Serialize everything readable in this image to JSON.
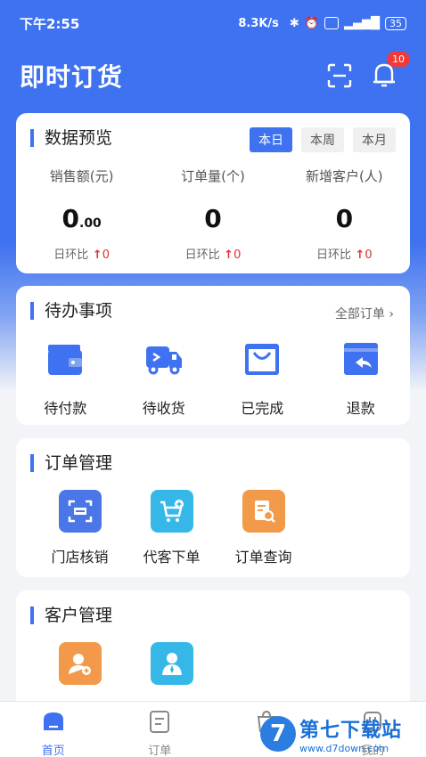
{
  "status_bar": {
    "time": "下午2:55",
    "network_speed": "8.3K/s",
    "battery": "35"
  },
  "header": {
    "title": "即时订货",
    "notification_count": "10"
  },
  "data_preview": {
    "title": "数据预览",
    "tabs": [
      {
        "label": "本日",
        "active": true
      },
      {
        "label": "本周",
        "active": false
      },
      {
        "label": "本月",
        "active": false
      }
    ],
    "stats": [
      {
        "label": "销售额(元)",
        "value_int": "0",
        "value_dec": ".00",
        "compare_label": "日环比",
        "compare_value": "0"
      },
      {
        "label": "订单量(个)",
        "value_int": "0",
        "value_dec": "",
        "compare_label": "日环比",
        "compare_value": "0"
      },
      {
        "label": "新增客户(人)",
        "value_int": "0",
        "value_dec": "",
        "compare_label": "日环比",
        "compare_value": "0"
      }
    ]
  },
  "todo": {
    "title": "待办事项",
    "all_orders": "全部订单 ›",
    "items": [
      {
        "label": "待付款",
        "icon": "wallet-icon"
      },
      {
        "label": "待收货",
        "icon": "truck-icon"
      },
      {
        "label": "已完成",
        "icon": "bag-icon"
      },
      {
        "label": "退款",
        "icon": "refund-icon"
      }
    ]
  },
  "order_mgmt": {
    "title": "订单管理",
    "items": [
      {
        "label": "门店核销",
        "icon": "scan-verify-icon",
        "color": "#4a76e8"
      },
      {
        "label": "代客下单",
        "icon": "cart-add-icon",
        "color": "#35b8e8"
      },
      {
        "label": "订单查询",
        "icon": "order-search-icon",
        "color": "#f29a4a"
      }
    ]
  },
  "customer_mgmt": {
    "title": "客户管理",
    "items": [
      {
        "icon": "add-customer-icon",
        "color": "#f29a4a"
      },
      {
        "icon": "customer-list-icon",
        "color": "#35b8e8"
      }
    ]
  },
  "bottom_nav": [
    {
      "label": "首页",
      "icon": "home-icon",
      "active": true
    },
    {
      "label": "订单",
      "icon": "order-icon",
      "active": false
    },
    {
      "label": "",
      "icon": "goods-icon",
      "active": false
    },
    {
      "label": "我的",
      "icon": "profile-icon",
      "active": false
    }
  ],
  "watermark": {
    "logo": "7",
    "title": "第七下载站",
    "url": "www.d7down.com"
  },
  "colors": {
    "primary": "#3f72f0",
    "alert": "#f03a3a"
  }
}
